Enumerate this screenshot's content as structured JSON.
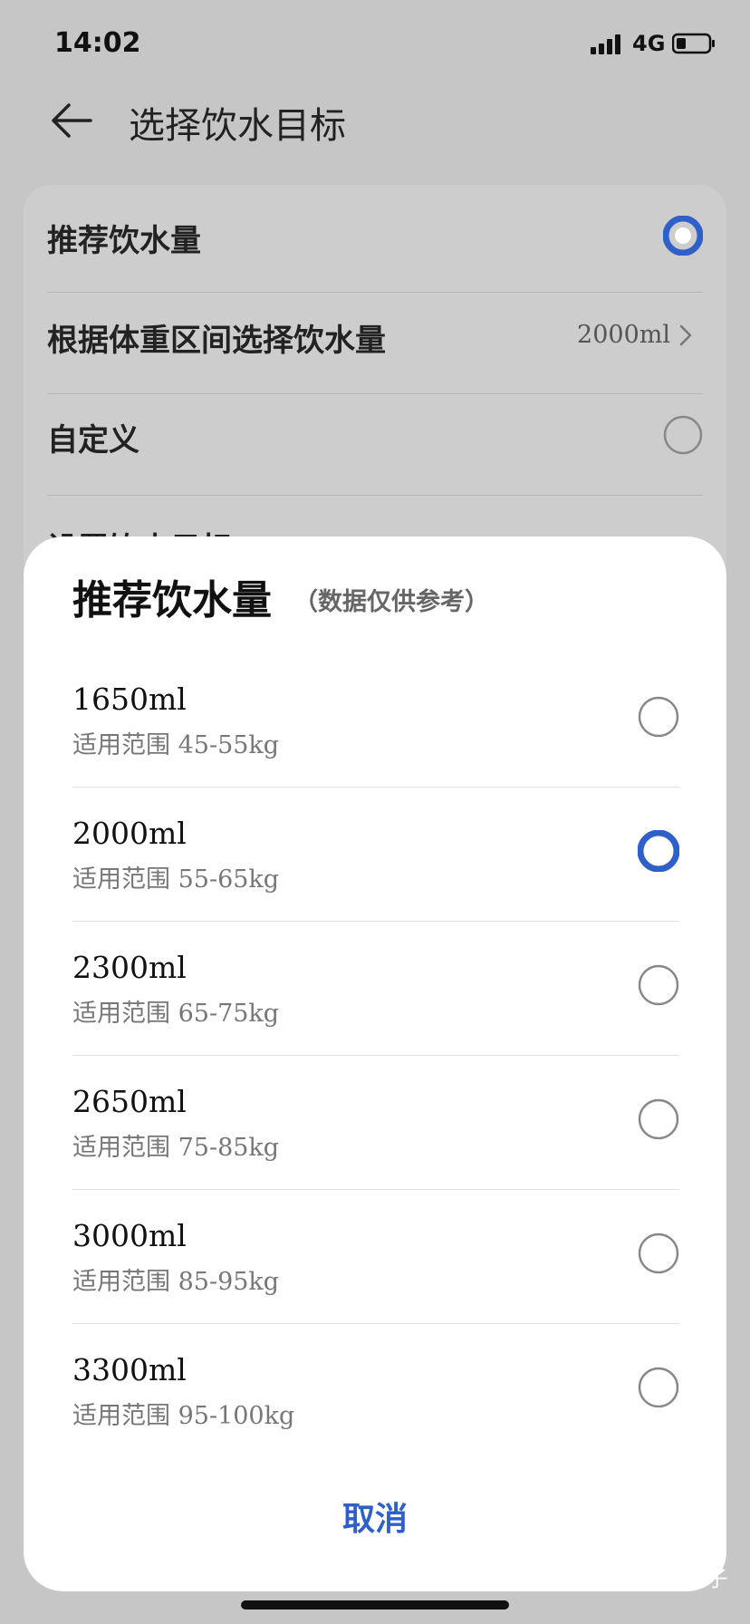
{
  "status_bar": {
    "time": "14:02",
    "network": "4G",
    "icons": [
      "signal-icon",
      "battery-icon"
    ]
  },
  "header": {
    "back_icon": "back-arrow-icon",
    "title": "选择饮水目标"
  },
  "settings": {
    "rows": [
      {
        "label": "推荐饮水量",
        "selected": true
      },
      {
        "label": "根据体重区间选择饮水量",
        "value": "2000ml"
      },
      {
        "label": "自定义",
        "selected": false
      },
      {
        "label": "设置饮水目标"
      }
    ]
  },
  "sheet": {
    "title": "推荐饮水量",
    "note": "（数据仅供参考）",
    "options": [
      {
        "amount": "1650ml",
        "range_label": "适用范围",
        "range_value": "45-55kg",
        "selected": false
      },
      {
        "amount": "2000ml",
        "range_label": "适用范围",
        "range_value": "55-65kg",
        "selected": true
      },
      {
        "amount": "2300ml",
        "range_label": "适用范围",
        "range_value": "65-75kg",
        "selected": false
      },
      {
        "amount": "2650ml",
        "range_label": "适用范围",
        "range_value": "75-85kg",
        "selected": false
      },
      {
        "amount": "3000ml",
        "range_label": "适用范围",
        "range_value": "85-95kg",
        "selected": false
      },
      {
        "amount": "3300ml",
        "range_label": "适用范围",
        "range_value": "95-100kg",
        "selected": false
      }
    ],
    "cancel_label": "取消"
  },
  "watermark": "知乎 @七公子",
  "colors": {
    "accent": "#2f5fc8",
    "overlay": "#c6c6c6",
    "sheet": "#ffffff"
  }
}
